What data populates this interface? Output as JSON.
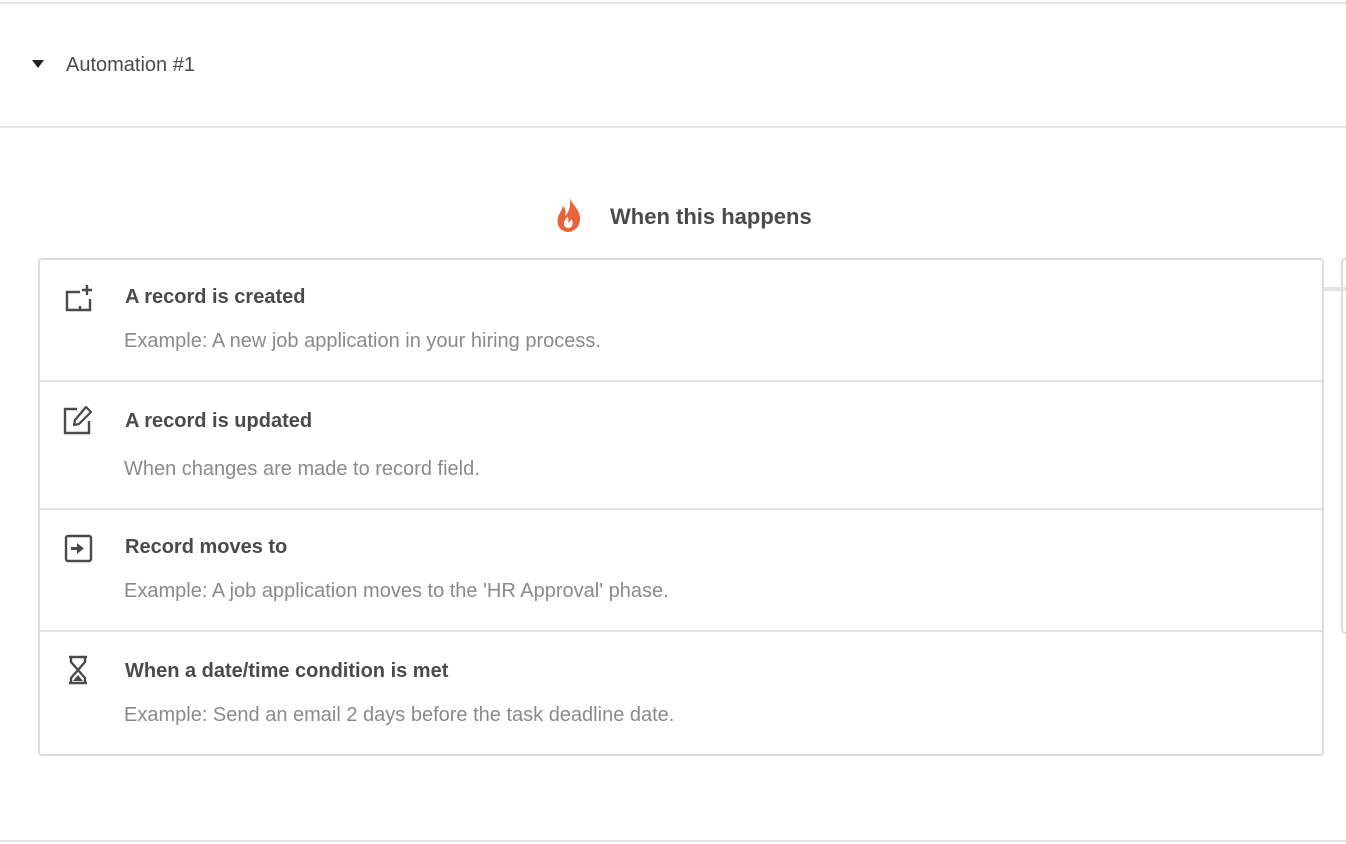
{
  "automation": {
    "title": "Automation #1",
    "expanded": true
  },
  "section": {
    "title": "When this happens",
    "icon": "fire-icon",
    "accent_color": "#e8643c"
  },
  "triggers": [
    {
      "icon": "record-created-icon",
      "title": "A record is created",
      "description": "Example: A new job application in your hiring process."
    },
    {
      "icon": "edit-icon",
      "title": "A record is updated",
      "description": "When changes are made to record field."
    },
    {
      "icon": "move-to-icon",
      "title": "Record moves to",
      "description": "Example: A job application moves to the 'HR Approval' phase."
    },
    {
      "icon": "hourglass-icon",
      "title": "When a date/time condition is met",
      "description": "Example: Send an email 2 days before the task deadline date."
    }
  ],
  "colors": {
    "title_text": "#4a4a4a",
    "description_text": "#8a8a8a",
    "border": "#dcdcdc"
  }
}
